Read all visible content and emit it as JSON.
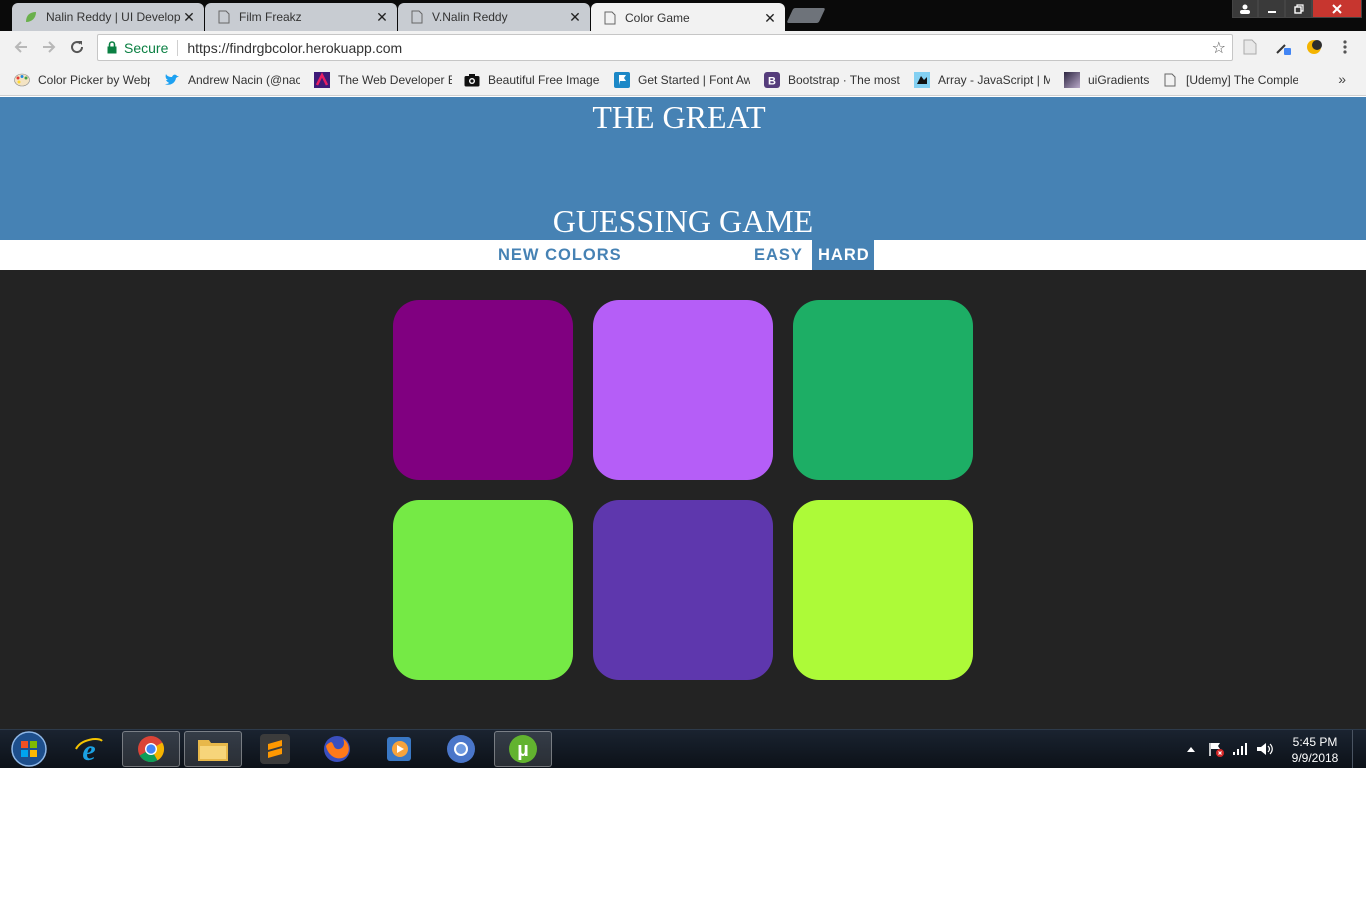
{
  "browser": {
    "tabs": [
      {
        "title": "Nalin Reddy | UI Develop",
        "icon": "leaf-icon",
        "active": false
      },
      {
        "title": "Film Freakz",
        "icon": "document-icon",
        "active": false
      },
      {
        "title": "V.Nalin Reddy",
        "icon": "document-icon",
        "active": false
      },
      {
        "title": "Color Game",
        "icon": "document-icon",
        "active": true
      }
    ],
    "omnibox": {
      "secure_label": "Secure",
      "url": "https://findrgbcolor.herokuapp.com"
    },
    "bookmarks": [
      {
        "label": "Color Picker by Webp",
        "icon": "palette-icon"
      },
      {
        "label": "Andrew Nacin (@nac",
        "icon": "twitter-icon"
      },
      {
        "label": "The Web Developer E",
        "icon": "course-icon"
      },
      {
        "label": "Beautiful Free Images",
        "icon": "camera-icon"
      },
      {
        "label": "Get Started | Font Aw",
        "icon": "flag-icon"
      },
      {
        "label": "Bootstrap · The most",
        "icon": "bootstrap-icon"
      },
      {
        "label": "Array - JavaScript | M",
        "icon": "mdn-icon"
      },
      {
        "label": "uiGradients",
        "icon": "gradient-icon"
      },
      {
        "label": "[Udemy] The Comple",
        "icon": "document-icon"
      }
    ],
    "more_bookmarks": "»"
  },
  "game": {
    "title_line1": "THE GREAT",
    "title_line2": "GUESSING GAME",
    "new_colors_label": "NEW COLORS",
    "easy_label": "EASY",
    "hard_label": "HARD",
    "mode": "hard",
    "square_colors": [
      "#800080",
      "#b55ef7",
      "#1dae65",
      "#75ea45",
      "#5e37ad",
      "#adfa38"
    ]
  },
  "taskbar": {
    "apps": [
      "windows-start-icon",
      "internet-explorer-icon",
      "chrome-icon",
      "file-explorer-icon",
      "sublime-text-icon",
      "firefox-icon",
      "media-player-icon",
      "chromium-icon",
      "utorrent-icon"
    ],
    "time": "5:45 PM",
    "date": "9/9/2018"
  }
}
